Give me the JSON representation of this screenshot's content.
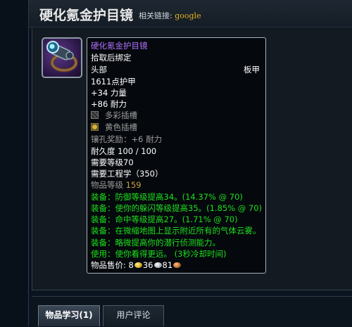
{
  "header": {
    "title": "硬化氪金护目镜",
    "related_label": "相关链接:",
    "related_link": "google"
  },
  "item_icon": {
    "icon": "goggles-icon"
  },
  "tooltip": {
    "name": "硬化氪金护目镜",
    "bind": "拾取后绑定",
    "slot": "头部",
    "armor_type": "板甲",
    "armor": "1611点护甲",
    "strength": "+34 力量",
    "stamina": "+86 耐力",
    "socket_prismatic": "多彩插槽",
    "socket_yellow": "黄色插槽",
    "socket_bonus": "镶孔奖励：+6 耐力",
    "durability": "耐久度 100 / 100",
    "req_level": "需要等级70",
    "req_skill": "需要工程学（350）",
    "item_level_label": "物品等级",
    "item_level_value": "159",
    "equip_lines": [
      "装备：防御等级提高34。(14.37% @ 70)",
      "装备：使你的躲闪等级提高35。(1.85% @ 70)",
      "装备：命中等级提高27。(1.71% @ 70)",
      "装备：在微缩地图上显示附近所有的气体云雾。",
      "装备：略微提高你的潜行侦测能力。",
      "使用：使你看得更远。 (3秒冷却时间)"
    ],
    "sell_price_label": "物品售价: ",
    "sell_gold": "8",
    "sell_silver": "36",
    "sell_copper": "81",
    "colors": {
      "name": "#b070ff",
      "green_text": "#1ee01e",
      "gray_text": "#9c9c9c",
      "item_level": "#c9a23a"
    }
  },
  "tabs": [
    {
      "label": "物品学习(1)",
      "active": true
    },
    {
      "label": "用户评论",
      "active": false
    }
  ]
}
